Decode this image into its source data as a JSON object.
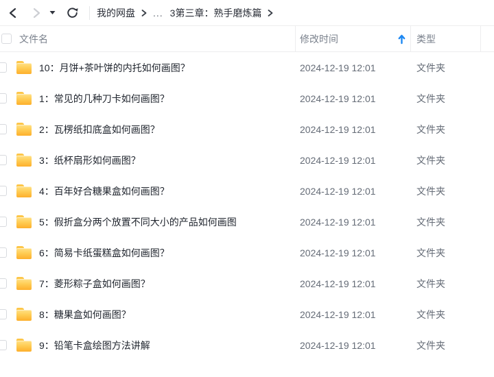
{
  "topbar": {
    "back_icon": "chevron-left",
    "forward_icon": "chevron-right",
    "history_dropdown_icon": "caret-down",
    "refresh_icon": "refresh",
    "breadcrumb": {
      "items": [
        "我的网盘",
        "...",
        "3第三章：熟手磨炼篇"
      ]
    }
  },
  "table": {
    "header": {
      "name_label": "文件名",
      "modified_label": "修改时间",
      "type_label": "类型"
    },
    "sort": {
      "column": "修改时间",
      "direction": "ascending",
      "icon": "arrow-up"
    },
    "rows": [
      {
        "name": "10：月饼+茶叶饼的内托如何画图？",
        "modified": "2024-12-19 12:01",
        "type": "文件夹"
      },
      {
        "name": "1：常见的几种刀卡如何画图？",
        "modified": "2024-12-19 12:01",
        "type": "文件夹"
      },
      {
        "name": "2：瓦楞纸扣底盒如何画图？",
        "modified": "2024-12-19 12:01",
        "type": "文件夹"
      },
      {
        "name": "3：纸杯扇形如何画图？",
        "modified": "2024-12-19 12:01",
        "type": "文件夹"
      },
      {
        "name": "4：百年好合糖果盒如何画图？",
        "modified": "2024-12-19 12:01",
        "type": "文件夹"
      },
      {
        "name": "5：假折盒分两个放置不同大小的产品如何画图",
        "modified": "2024-12-19 12:01",
        "type": "文件夹"
      },
      {
        "name": "6：简易卡纸蛋糕盒如何画图？",
        "modified": "2024-12-19 12:01",
        "type": "文件夹"
      },
      {
        "name": "7：菱形粽子盒如何画图？",
        "modified": "2024-12-19 12:01",
        "type": "文件夹"
      },
      {
        "name": "8：糖果盒如何画图？",
        "modified": "2024-12-19 12:01",
        "type": "文件夹"
      },
      {
        "name": "9：铅笔卡盒绘图方法讲解",
        "modified": "2024-12-19 12:01",
        "type": "文件夹"
      }
    ]
  },
  "colors": {
    "sort_arrow_blue": "#1d88f2",
    "folder_yellow": "#ffc94f",
    "text_primary": "#1f242d",
    "text_secondary": "#646b76"
  }
}
